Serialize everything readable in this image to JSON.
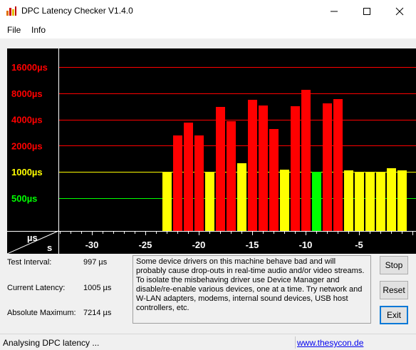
{
  "window": {
    "title": "DPC Latency Checker V1.4.0"
  },
  "menu": {
    "items": [
      "File",
      "Info"
    ]
  },
  "chart_data": {
    "type": "bar",
    "y_tick_labels": [
      {
        "label": "16000µs",
        "value": 16000,
        "color": "#ff0000"
      },
      {
        "label": "8000µs",
        "value": 8000,
        "color": "#ff0000"
      },
      {
        "label": "4000µs",
        "value": 4000,
        "color": "#ff0000"
      },
      {
        "label": "2000µs",
        "value": 2000,
        "color": "#ff0000"
      },
      {
        "label": "1000µs",
        "value": 1000,
        "color": "#ffff00"
      },
      {
        "label": "500µs",
        "value": 500,
        "color": "#00ff00"
      }
    ],
    "x_tick_labels": [
      "-30",
      "-25",
      "-20",
      "-15",
      "-10",
      "-5"
    ],
    "x_ticks": [
      -30,
      -25,
      -20,
      -15,
      -10,
      -5
    ],
    "x_range": [
      -35,
      0
    ],
    "corner_labels": {
      "y_unit": "µs",
      "x_unit": "s"
    },
    "scale": "log",
    "time_seconds": [
      -23,
      -22,
      -21,
      -20,
      -19,
      -18,
      -17,
      -16,
      -15,
      -14,
      -13,
      -12,
      -11,
      -10,
      -9,
      -8,
      -7,
      -6,
      -5,
      -4,
      -3,
      -2,
      -1
    ],
    "values_us": [
      1000,
      2600,
      3700,
      2600,
      1000,
      5600,
      3800,
      1250,
      6700,
      5800,
      3100,
      1070,
      5700,
      8700,
      1000,
      6100,
      6800,
      1050,
      1000,
      990,
      985,
      1100,
      1040
    ],
    "colors": {
      "green": "#00ff00",
      "yellow": "#ffff00",
      "red": "#ff0000",
      "background": "#000000",
      "axis": "#ffffff"
    },
    "bar_colors": [
      "yellow",
      "red",
      "red",
      "red",
      "yellow",
      "red",
      "red",
      "yellow",
      "red",
      "red",
      "red",
      "yellow",
      "red",
      "red",
      "green",
      "red",
      "red",
      "yellow",
      "yellow",
      "yellow",
      "yellow",
      "yellow",
      "yellow"
    ],
    "threshold_lines": [
      {
        "value": 500,
        "color": "#00ff00"
      },
      {
        "value": 1000,
        "color": "#ffff00"
      },
      {
        "value": 2000,
        "color": "#ff0000"
      },
      {
        "value": 4000,
        "color": "#ff0000"
      },
      {
        "value": 8000,
        "color": "#ff0000"
      },
      {
        "value": 16000,
        "color": "#ff0000"
      }
    ]
  },
  "stats": {
    "test_interval_label": "Test Interval:",
    "test_interval_value": "997 µs",
    "current_latency_label": "Current Latency:",
    "current_latency_value": "1005 µs",
    "absolute_max_label": "Absolute Maximum:",
    "absolute_max_value": "7214 µs"
  },
  "message": "Some device drivers on this machine behave bad and will probably cause drop-outs in real-time audio and/or video streams. To isolate the misbehaving driver use Device Manager and disable/re-enable various devices, one at a time. Try network and W-LAN adapters, modems, internal sound devices, USB host controllers, etc.",
  "buttons": {
    "stop": "Stop",
    "reset": "Reset",
    "exit": "Exit"
  },
  "status": {
    "text": "Analysing DPC latency ...",
    "link": "www.thesycon.de"
  },
  "icons": {
    "app": "bar-chart-icon",
    "minimize": "minimize-icon",
    "maximize": "maximize-icon",
    "close": "close-icon"
  }
}
